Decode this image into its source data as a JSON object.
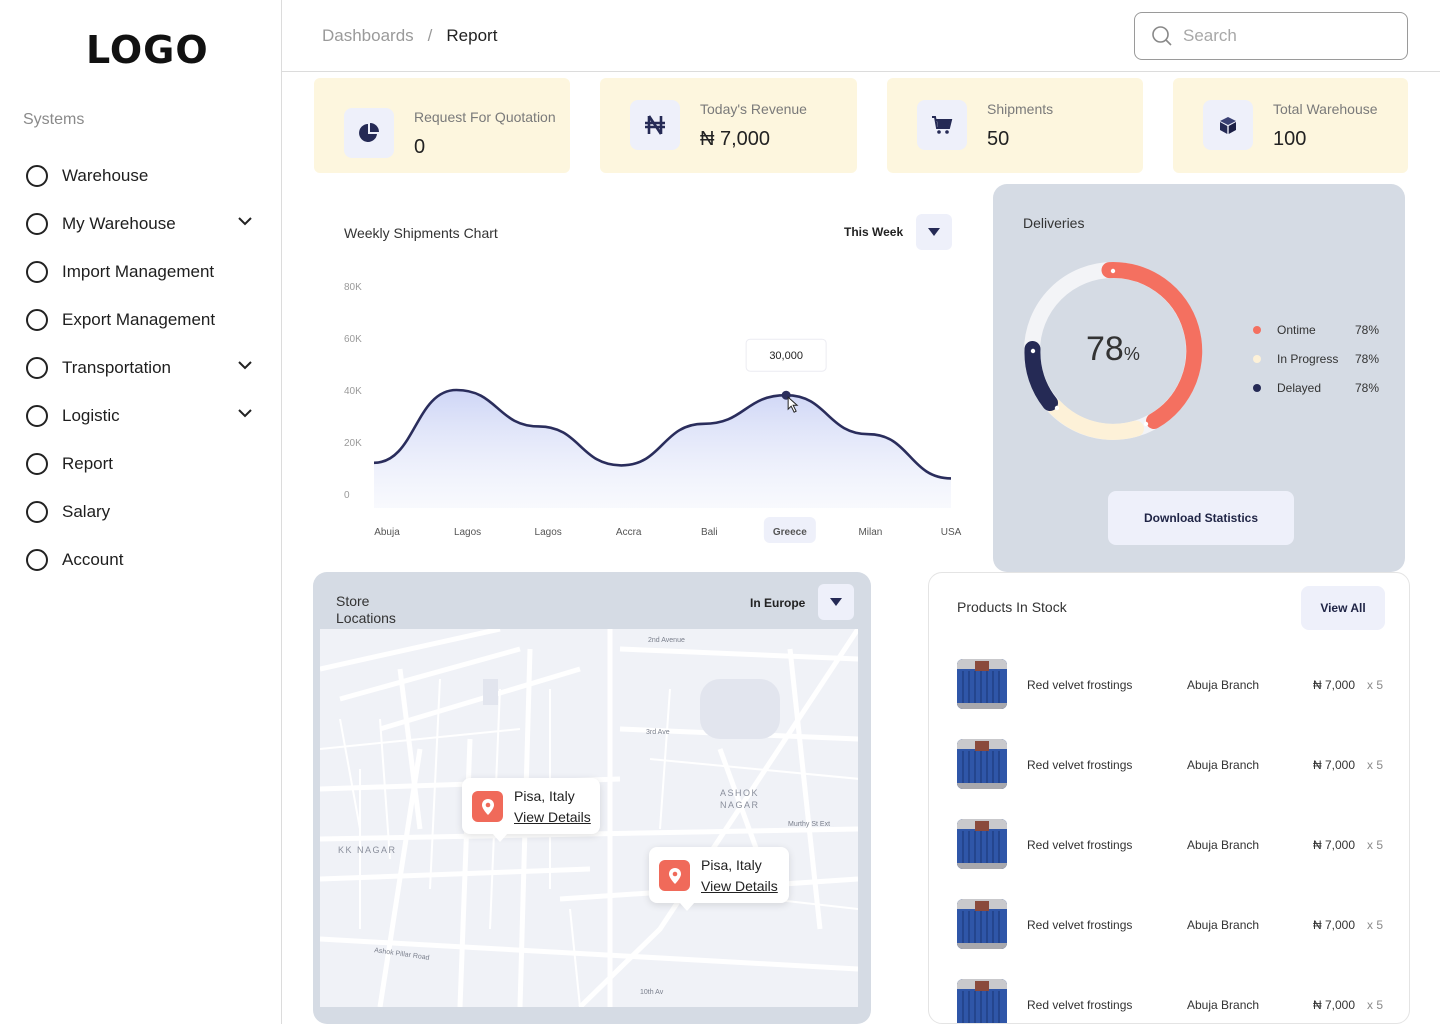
{
  "brand": {
    "logo_text": "LOGO"
  },
  "sidebar": {
    "section_label": "Systems",
    "items": [
      {
        "label": "Warehouse",
        "has_submenu": false
      },
      {
        "label": "My Warehouse",
        "has_submenu": true
      },
      {
        "label": "Import Management",
        "has_submenu": false
      },
      {
        "label": "Export Management",
        "has_submenu": false
      },
      {
        "label": "Transportation",
        "has_submenu": true
      },
      {
        "label": "Logistic",
        "has_submenu": true
      },
      {
        "label": "Report",
        "has_submenu": false
      },
      {
        "label": "Salary",
        "has_submenu": false
      },
      {
        "label": "Account",
        "has_submenu": false
      }
    ]
  },
  "header": {
    "breadcrumb": [
      "Dashboards",
      "Report"
    ],
    "breadcrumb_separator": "/",
    "search_placeholder": "Search"
  },
  "stats": [
    {
      "title": "Request For Quotation",
      "value": "0",
      "icon": "pie-chart-icon"
    },
    {
      "title": "Today's Revenue",
      "value": "₦ 7,000",
      "icon": "naira-icon"
    },
    {
      "title": "Shipments",
      "value": "50",
      "icon": "cart-icon"
    },
    {
      "title": "Total Warehouse",
      "value": "100",
      "icon": "box-icon"
    }
  ],
  "weekly_chart": {
    "title": "Weekly Shipments Chart",
    "period_label": "This Week",
    "tooltip_value": "30,000",
    "highlighted_category": "Greece"
  },
  "chart_data": {
    "type": "area",
    "title": "Weekly Shipments Chart",
    "categories": [
      "Abuja",
      "Lagos",
      "Lagos",
      "Accra",
      "Bali",
      "Greece",
      "Milan",
      "USA"
    ],
    "y_ticks": [
      "0",
      "20K",
      "40K",
      "60K",
      "80K"
    ],
    "ylim": [
      0,
      80000
    ],
    "values": [
      12000,
      40000,
      26000,
      11000,
      27000,
      38000,
      23000,
      6000
    ],
    "grid": false,
    "color": "#2a2d5c"
  },
  "deliveries": {
    "title": "Deliveries",
    "center_value": "78",
    "center_unit": "%",
    "legend": [
      {
        "label": "Ontime",
        "value": "78%",
        "color": "#f47060"
      },
      {
        "label": "In Progress",
        "value": "78%",
        "color": "#fdf1d8"
      },
      {
        "label": "Delayed",
        "value": "78%",
        "color": "#252a55"
      }
    ],
    "download_label": "Download Statistics"
  },
  "store_locations": {
    "title": "Store Locations",
    "filter_label": "In Europe",
    "markers": [
      {
        "place": "Pisa, Italy",
        "link": "View Details"
      },
      {
        "place": "Pisa, Italy",
        "link": "View Details"
      }
    ],
    "map_labels": {
      "kk_nagar": "KK NAGAR",
      "ashok_nagar": "ASHOK NAGAR",
      "ashok_pillar": "Ashok Pillar Road",
      "second_ave": "2nd Avenue",
      "third_ave": "3rd Ave",
      "murthy": "Murthy St Ext",
      "tenth": "10th Av"
    }
  },
  "products": {
    "title": "Products In Stock",
    "view_all_label": "View All",
    "rows": [
      {
        "name": "Red velvet frostings",
        "branch": "Abuja Branch",
        "price": "₦ 7,000",
        "qty": "x 5"
      },
      {
        "name": "Red velvet frostings",
        "branch": "Abuja Branch",
        "price": "₦ 7,000",
        "qty": "x 5"
      },
      {
        "name": "Red velvet frostings",
        "branch": "Abuja Branch",
        "price": "₦ 7,000",
        "qty": "x 5"
      },
      {
        "name": "Red velvet frostings",
        "branch": "Abuja Branch",
        "price": "₦ 7,000",
        "qty": "x 5"
      },
      {
        "name": "Red velvet frostings",
        "branch": "Abuja Branch",
        "price": "₦ 7,000",
        "qty": "x 5"
      }
    ]
  },
  "colors": {
    "card_bg": "#fdf6de",
    "panel_bg": "#d5dbe4",
    "accent_dark": "#252a55",
    "accent_coral": "#f47060"
  }
}
